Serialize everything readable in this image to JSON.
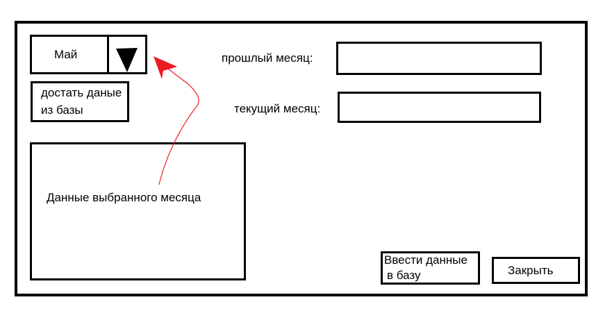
{
  "month_select": {
    "value": "Май",
    "icon": "triangle-down-icon"
  },
  "fetch_button": {
    "line1": "достать даные",
    "line2": "из базы"
  },
  "data_panel": {
    "label": "Данные выбранного месяца"
  },
  "fields": {
    "previous_month_label": "прошлый месяц:",
    "previous_month_value": "",
    "current_month_label": "текущий месяц:",
    "current_month_value": ""
  },
  "buttons": {
    "enter_line1": "Ввести данные",
    "enter_line2": "в базу",
    "close": "Закрыть"
  },
  "colors": {
    "arrow": "#ed1c24",
    "stroke": "#000000"
  }
}
